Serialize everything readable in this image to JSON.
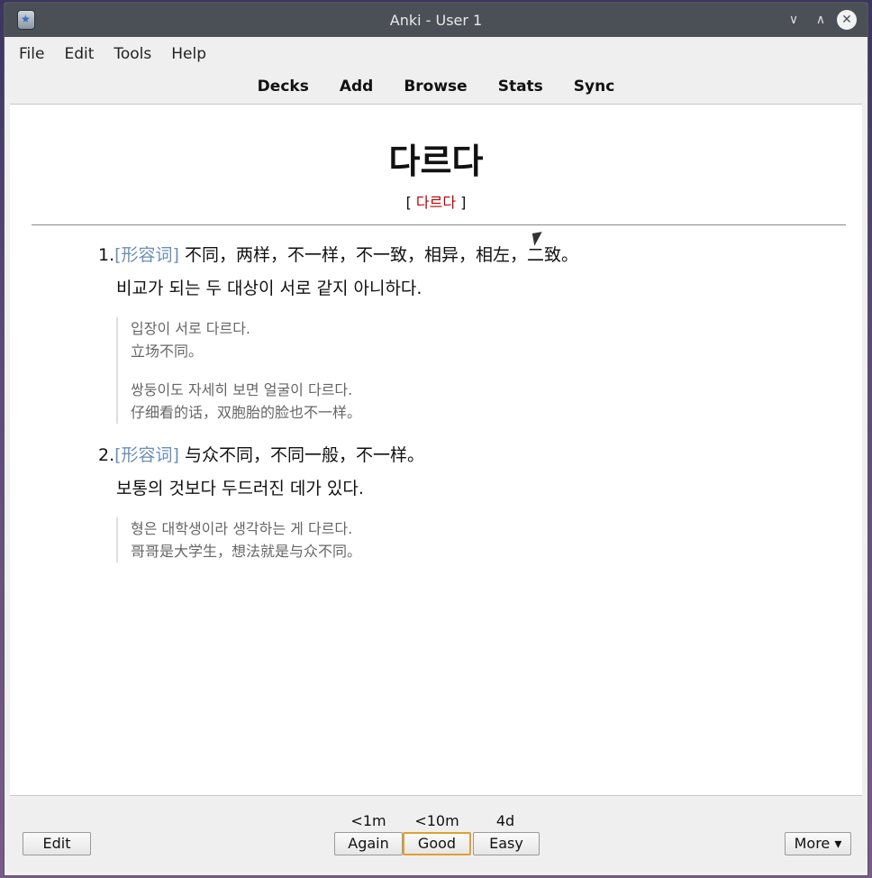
{
  "window": {
    "title": "Anki - User 1"
  },
  "menu": [
    "File",
    "Edit",
    "Tools",
    "Help"
  ],
  "toolbar": [
    "Decks",
    "Add",
    "Browse",
    "Stats",
    "Sync"
  ],
  "card": {
    "headword": "다르다",
    "pron_open": "[ ",
    "pron_word": "다르다",
    "pron_close": " ]",
    "senses": [
      {
        "num": "1.",
        "pos": "[形容词]",
        "zh": " 不同，两样，不一样，不一致，相异，相左，二致。",
        "ko": "비교가 되는 두 대상이 서로 같지 아니하다.",
        "examples": [
          {
            "ko": "입장이 서로 다르다.",
            "zh": "立场不同。"
          },
          {
            "ko": "쌍둥이도 자세히 보면 얼굴이 다르다.",
            "zh": "仔细看的话，双胞胎的脸也不一样。"
          }
        ]
      },
      {
        "num": "2.",
        "pos": "[形容词]",
        "zh": " 与众不同，不同一般，不一样。",
        "ko": "보통의 것보다 두드러진 데가 있다.",
        "examples": [
          {
            "ko": "형은 대학생이라 생각하는 게 다르다.",
            "zh": "哥哥是大学生，想法就是与众不同。"
          }
        ]
      }
    ]
  },
  "bottom": {
    "edit": "Edit",
    "more": "More ▾",
    "answers": [
      {
        "ivl": "<1m",
        "label": "Again"
      },
      {
        "ivl": "<10m",
        "label": "Good"
      },
      {
        "ivl": "4d",
        "label": "Easy"
      }
    ]
  },
  "colors": {
    "pos": "#6a8fb8",
    "pron": "#c00000",
    "focus": "#e0a030"
  }
}
